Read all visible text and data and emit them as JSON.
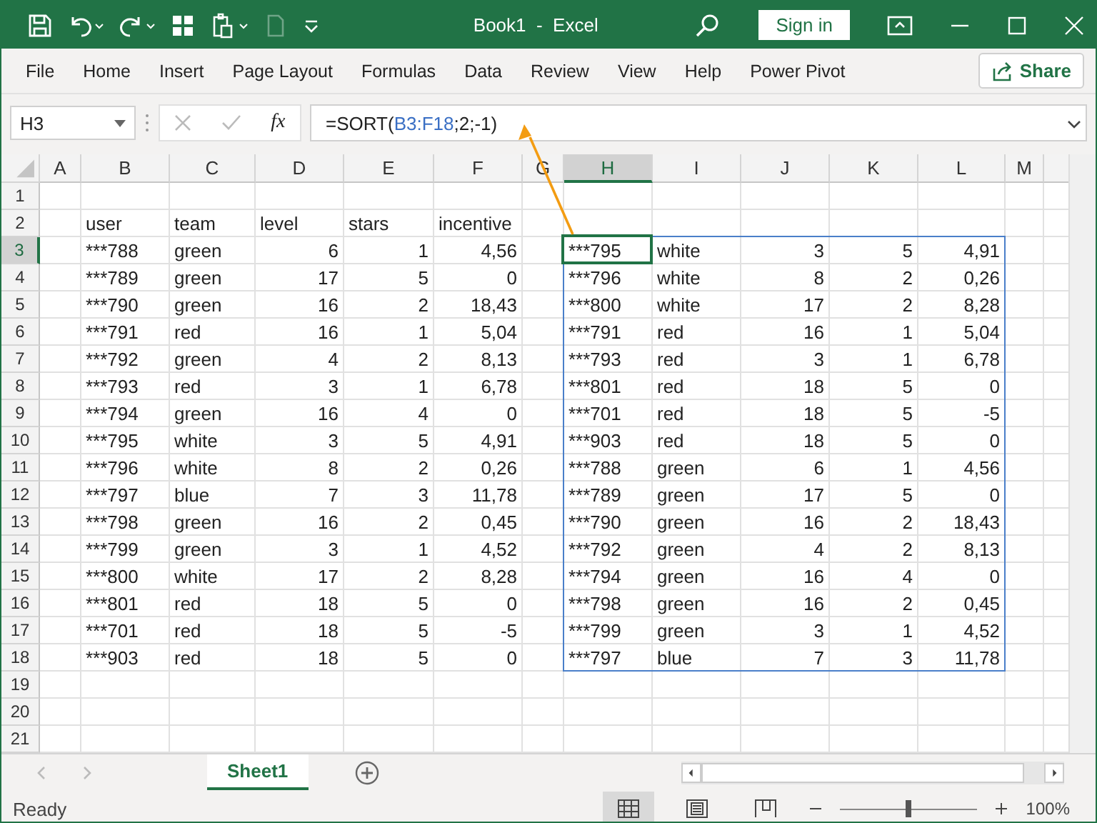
{
  "window": {
    "title": "Book1  -  Excel",
    "sign_in": "Sign in"
  },
  "ribbon_tabs": [
    {
      "label": "File",
      "selected": false
    },
    {
      "label": "Home",
      "selected": false
    },
    {
      "label": "Insert",
      "selected": false
    },
    {
      "label": "Page Layout",
      "selected": false
    },
    {
      "label": "Formulas",
      "selected": false
    },
    {
      "label": "Data",
      "selected": false
    },
    {
      "label": "Review",
      "selected": false
    },
    {
      "label": "View",
      "selected": false
    },
    {
      "label": "Help",
      "selected": false
    },
    {
      "label": "Power Pivot",
      "selected": false
    }
  ],
  "share_button": "Share",
  "formula_bar": {
    "name_box": "H3",
    "function_button": "fx",
    "formula": [
      {
        "text": "=SORT(",
        "kind": "plain"
      },
      {
        "text": "B3:F18",
        "kind": "reference"
      },
      {
        "text": ";2;-1)",
        "kind": "plain"
      }
    ]
  },
  "columns": [
    {
      "label": "A",
      "selected": false
    },
    {
      "label": "B",
      "selected": false
    },
    {
      "label": "C",
      "selected": false
    },
    {
      "label": "D",
      "selected": false
    },
    {
      "label": "E",
      "selected": false
    },
    {
      "label": "F",
      "selected": false
    },
    {
      "label": "G",
      "selected": false
    },
    {
      "label": "H",
      "selected": true
    },
    {
      "label": "I",
      "selected": false
    },
    {
      "label": "J",
      "selected": false
    },
    {
      "label": "K",
      "selected": false
    },
    {
      "label": "L",
      "selected": false
    },
    {
      "label": "M",
      "selected": false
    }
  ],
  "rows": [
    {
      "number": "1",
      "selected": false
    },
    {
      "number": "2",
      "selected": false,
      "kind": "header",
      "source": [
        "user",
        "team",
        "level",
        "stars",
        "incentive"
      ]
    },
    {
      "number": "3",
      "selected": true,
      "kind": "data",
      "source": [
        "***788",
        "green",
        "6",
        "1",
        "4,56"
      ],
      "result": [
        "***795",
        "white",
        "3",
        "5",
        "4,91"
      ]
    },
    {
      "number": "4",
      "selected": false,
      "kind": "data",
      "source": [
        "***789",
        "green",
        "17",
        "5",
        "0"
      ],
      "result": [
        "***796",
        "white",
        "8",
        "2",
        "0,26"
      ]
    },
    {
      "number": "5",
      "selected": false,
      "kind": "data",
      "source": [
        "***790",
        "green",
        "16",
        "2",
        "18,43"
      ],
      "result": [
        "***800",
        "white",
        "17",
        "2",
        "8,28"
      ]
    },
    {
      "number": "6",
      "selected": false,
      "kind": "data",
      "source": [
        "***791",
        "red",
        "16",
        "1",
        "5,04"
      ],
      "result": [
        "***791",
        "red",
        "16",
        "1",
        "5,04"
      ]
    },
    {
      "number": "7",
      "selected": false,
      "kind": "data",
      "source": [
        "***792",
        "green",
        "4",
        "2",
        "8,13"
      ],
      "result": [
        "***793",
        "red",
        "3",
        "1",
        "6,78"
      ]
    },
    {
      "number": "8",
      "selected": false,
      "kind": "data",
      "source": [
        "***793",
        "red",
        "3",
        "1",
        "6,78"
      ],
      "result": [
        "***801",
        "red",
        "18",
        "5",
        "0"
      ]
    },
    {
      "number": "9",
      "selected": false,
      "kind": "data",
      "source": [
        "***794",
        "green",
        "16",
        "4",
        "0"
      ],
      "result": [
        "***701",
        "red",
        "18",
        "5",
        "-5"
      ]
    },
    {
      "number": "10",
      "selected": false,
      "kind": "data",
      "source": [
        "***795",
        "white",
        "3",
        "5",
        "4,91"
      ],
      "result": [
        "***903",
        "red",
        "18",
        "5",
        "0"
      ]
    },
    {
      "number": "11",
      "selected": false,
      "kind": "data",
      "source": [
        "***796",
        "white",
        "8",
        "2",
        "0,26"
      ],
      "result": [
        "***788",
        "green",
        "6",
        "1",
        "4,56"
      ]
    },
    {
      "number": "12",
      "selected": false,
      "kind": "data",
      "source": [
        "***797",
        "blue",
        "7",
        "3",
        "11,78"
      ],
      "result": [
        "***789",
        "green",
        "17",
        "5",
        "0"
      ]
    },
    {
      "number": "13",
      "selected": false,
      "kind": "data",
      "source": [
        "***798",
        "green",
        "16",
        "2",
        "0,45"
      ],
      "result": [
        "***790",
        "green",
        "16",
        "2",
        "18,43"
      ]
    },
    {
      "number": "14",
      "selected": false,
      "kind": "data",
      "source": [
        "***799",
        "green",
        "3",
        "1",
        "4,52"
      ],
      "result": [
        "***792",
        "green",
        "4",
        "2",
        "8,13"
      ]
    },
    {
      "number": "15",
      "selected": false,
      "kind": "data",
      "source": [
        "***800",
        "white",
        "17",
        "2",
        "8,28"
      ],
      "result": [
        "***794",
        "green",
        "16",
        "4",
        "0"
      ]
    },
    {
      "number": "16",
      "selected": false,
      "kind": "data",
      "source": [
        "***801",
        "red",
        "18",
        "5",
        "0"
      ],
      "result": [
        "***798",
        "green",
        "16",
        "2",
        "0,45"
      ]
    },
    {
      "number": "17",
      "selected": false,
      "kind": "data",
      "source": [
        "***701",
        "red",
        "18",
        "5",
        "-5"
      ],
      "result": [
        "***799",
        "green",
        "3",
        "1",
        "4,52"
      ]
    },
    {
      "number": "18",
      "selected": false,
      "kind": "data",
      "source": [
        "***903",
        "red",
        "18",
        "5",
        "0"
      ],
      "result": [
        "***797",
        "blue",
        "7",
        "3",
        "11,78"
      ]
    },
    {
      "number": "19",
      "selected": false
    },
    {
      "number": "20",
      "selected": false
    },
    {
      "number": "21",
      "selected": false
    }
  ],
  "sheet_tabs": [
    {
      "label": "Sheet1",
      "selected": true
    }
  ],
  "status_bar": {
    "status": "Ready",
    "zoom": "100%",
    "zoom_slider": {
      "level": 0.5
    },
    "views": [
      {
        "kind": "normal",
        "selected": true
      },
      {
        "kind": "page-layout",
        "selected": false
      },
      {
        "kind": "page-break",
        "selected": false
      }
    ]
  }
}
